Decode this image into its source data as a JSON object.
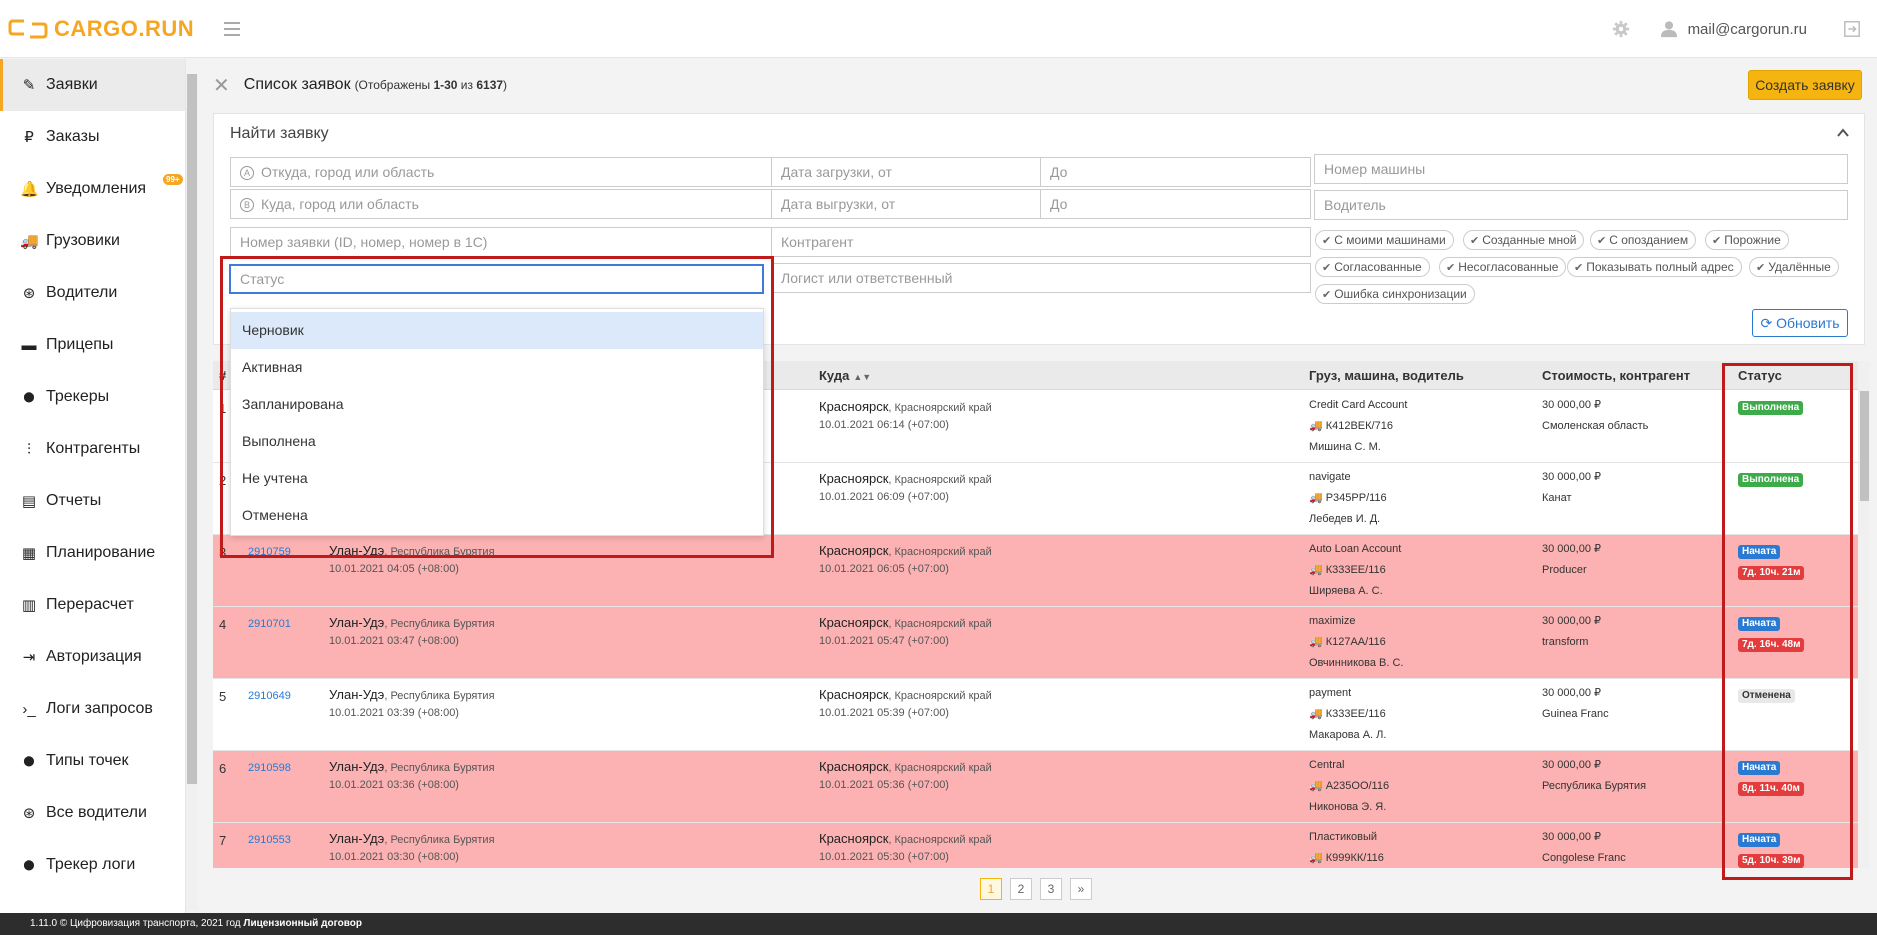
{
  "app": {
    "logo": "CARGO.RUN",
    "user_email": "mail@cargorun.ru"
  },
  "sidebar": {
    "items": [
      {
        "label": "Заявки",
        "icon": "edit-icon"
      },
      {
        "label": "Заказы",
        "icon": "ruble-icon"
      },
      {
        "label": "Уведомления",
        "icon": "bell-icon",
        "badge": "99+"
      },
      {
        "label": "Грузовики",
        "icon": "truck-icon"
      },
      {
        "label": "Водители",
        "icon": "steering-wheel-icon"
      },
      {
        "label": "Прицепы",
        "icon": "trailer-icon"
      },
      {
        "label": "Трекеры",
        "icon": "map-pin-icon"
      },
      {
        "label": "Контрагенты",
        "icon": "contractor-icon"
      },
      {
        "label": "Отчеты",
        "icon": "report-icon"
      },
      {
        "label": "Планирование",
        "icon": "calendar-icon"
      },
      {
        "label": "Перерасчет",
        "icon": "calculator-icon"
      },
      {
        "label": "Авторизация",
        "icon": "login-icon"
      },
      {
        "label": "Логи запросов",
        "icon": "terminal-icon"
      },
      {
        "label": "Типы точек",
        "icon": "map-pin-icon"
      },
      {
        "label": "Все водители",
        "icon": "steering-wheel-icon"
      },
      {
        "label": "Трекер логи",
        "icon": "map-pin-icon"
      }
    ]
  },
  "page": {
    "title": "Список заявок",
    "sub_prefix": "(Отображены ",
    "sub_range": "1-30",
    "sub_mid": " из ",
    "sub_total": "6137",
    "sub_suffix": ")",
    "create_button": "Создать заявку"
  },
  "filter": {
    "title": "Найти заявку",
    "from_placeholder": "Откуда, город или область",
    "from_marker": "A",
    "to_placeholder": "Куда, город или область",
    "to_marker": "B",
    "load_from": "Дата загрузки, от",
    "load_to": "До",
    "unload_from": "Дата выгрузки, от",
    "unload_to": "До",
    "truck_number": "Номер машины",
    "driver": "Водитель",
    "order_number": "Номер заявки (ID, номер, номер в 1С)",
    "contractor": "Контрагент",
    "status": "Статус",
    "logist": "Логист или ответственный",
    "chips": [
      "С моими машинами",
      "Созданные мной",
      "С опозданием",
      "Порожние",
      "Согласованные",
      "Несогласованные",
      "Показывать полный адрес",
      "Удалённые",
      "Ошибка синхронизации"
    ],
    "refresh": "Обновить"
  },
  "status_options": [
    "Черновик",
    "Активная",
    "Запланирована",
    "Выполнена",
    "Не учтена",
    "Отменена"
  ],
  "table": {
    "headers": {
      "num": "#",
      "to": "Куда",
      "cargo": "Груз, машина, водитель",
      "cost": "Стоимость, контрагент",
      "status": "Статус"
    },
    "rows": [
      {
        "num": "1",
        "id": "",
        "from_city": "",
        "from_region": "",
        "from_date": "",
        "to_city": "Красноярск",
        "to_region": ", Красноярский край",
        "to_date": "10.01.2021 06:14 (+07:00)",
        "cargo": "Credit Card Account",
        "truck": "К412ВЕК/716",
        "driver": "Мишина С. М.",
        "cost": "30 000,00 ₽",
        "contractor": "Смоленская область",
        "status": "Выполнена",
        "status_color": "green",
        "delay": "",
        "red": false
      },
      {
        "num": "2",
        "id": "",
        "from_city": "",
        "from_region": "",
        "from_date": "",
        "to_city": "Красноярск",
        "to_region": ", Красноярский край",
        "to_date": "10.01.2021 06:09 (+07:00)",
        "cargo": "navigate",
        "truck": "Р345РР/116",
        "driver": "Лебедев И. Д.",
        "cost": "30 000,00 ₽",
        "contractor": "Канат",
        "status": "Выполнена",
        "status_color": "green",
        "delay": "",
        "red": false
      },
      {
        "num": "3",
        "id": "2910759",
        "from_city": "Улан-Удэ",
        "from_region": ", Республика Бурятия",
        "from_date": "10.01.2021 04:05 (+08:00)",
        "to_city": "Красноярск",
        "to_region": ", Красноярский край",
        "to_date": "10.01.2021 06:05 (+07:00)",
        "cargo": "Auto Loan Account",
        "truck": "К333ЕЕ/116",
        "driver": "Ширяева А. С.",
        "cost": "30 000,00 ₽",
        "contractor": "Producer",
        "status": "Начата",
        "status_color": "blue",
        "delay": "7д. 10ч. 21м",
        "red": true
      },
      {
        "num": "4",
        "id": "2910701",
        "from_city": "Улан-Удэ",
        "from_region": ", Республика Бурятия",
        "from_date": "10.01.2021 03:47 (+08:00)",
        "to_city": "Красноярск",
        "to_region": ", Красноярский край",
        "to_date": "10.01.2021 05:47 (+07:00)",
        "cargo": "maximize",
        "truck": "К127АА/116",
        "driver": "Овчинникова В. С.",
        "cost": "30 000,00 ₽",
        "contractor": "transform",
        "status": "Начата",
        "status_color": "blue",
        "delay": "7д. 16ч. 48м",
        "red": true
      },
      {
        "num": "5",
        "id": "2910649",
        "from_city": "Улан-Удэ",
        "from_region": ", Республика Бурятия",
        "from_date": "10.01.2021 03:39 (+08:00)",
        "to_city": "Красноярск",
        "to_region": ", Красноярский край",
        "to_date": "10.01.2021 05:39 (+07:00)",
        "cargo": "payment",
        "truck": "К333ЕЕ/116",
        "driver": "Макарова А. Л.",
        "cost": "30 000,00 ₽",
        "contractor": "Guinea Franc",
        "status": "Отменена",
        "status_color": "gray",
        "delay": "",
        "red": false
      },
      {
        "num": "6",
        "id": "2910598",
        "from_city": "Улан-Удэ",
        "from_region": ", Республика Бурятия",
        "from_date": "10.01.2021 03:36 (+08:00)",
        "to_city": "Красноярск",
        "to_region": ", Красноярский край",
        "to_date": "10.01.2021 05:36 (+07:00)",
        "cargo": "Central",
        "truck": "А235ОО/116",
        "driver": "Никонова Э. Я.",
        "cost": "30 000,00 ₽",
        "contractor": "Республика Бурятия",
        "status": "Начата",
        "status_color": "blue",
        "delay": "8д. 11ч. 40м",
        "red": true
      },
      {
        "num": "7",
        "id": "2910553",
        "from_city": "Улан-Удэ",
        "from_region": ", Республика Бурятия",
        "from_date": "10.01.2021 03:30 (+08:00)",
        "to_city": "Красноярск",
        "to_region": ", Красноярский край",
        "to_date": "10.01.2021 05:30 (+07:00)",
        "cargo": "Пластиковый",
        "truck": "К999КК/116",
        "driver": "",
        "cost": "30 000,00 ₽",
        "contractor": "Congolese Franc",
        "status": "Начата",
        "status_color": "blue",
        "delay": "5д. 10ч. 39м",
        "red": true
      }
    ]
  },
  "pagination": [
    "1",
    "2",
    "3",
    "»"
  ],
  "footer": {
    "version": "1.11.0 © Цифровизация транспорта, 2021 год ",
    "license": "Лицензионный договор"
  }
}
